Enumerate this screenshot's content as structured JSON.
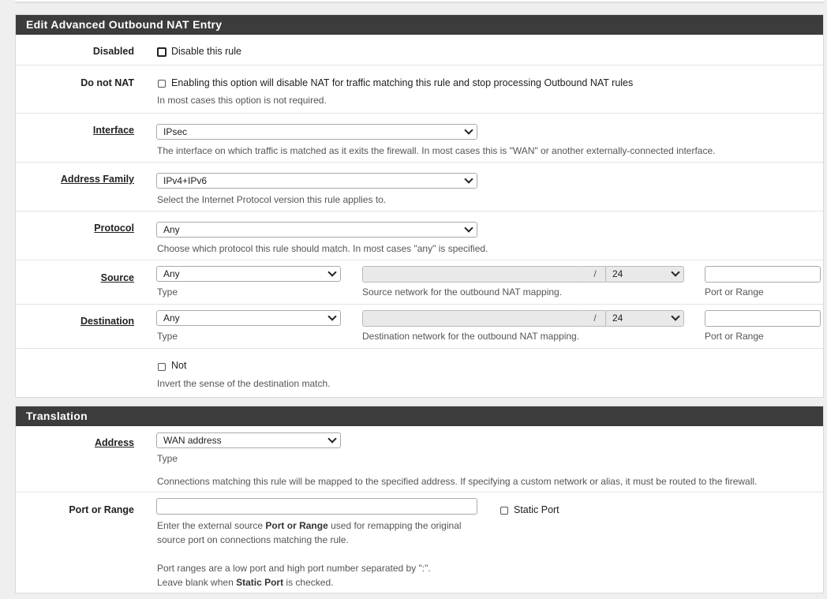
{
  "nat_panel": {
    "heading": "Edit Advanced Outbound NAT Entry",
    "disabled": {
      "label": "Disabled",
      "checkbox_text": "Disable this rule"
    },
    "do_not_nat": {
      "label": "Do not NAT",
      "checkbox_text": "Enabling this option will disable NAT for traffic matching this rule and stop processing Outbound NAT rules",
      "help": "In most cases this option is not required."
    },
    "interface": {
      "label": "Interface",
      "value": "IPsec",
      "help": "The interface on which traffic is matched as it exits the firewall. In most cases this is \"WAN\" or another externally-connected interface."
    },
    "address_family": {
      "label": "Address Family",
      "value": "IPv4+IPv6",
      "help": "Select the Internet Protocol version this rule applies to."
    },
    "protocol": {
      "label": "Protocol",
      "value": "Any",
      "help": "Choose which protocol this rule should match. In most cases \"any\" is specified."
    },
    "source": {
      "label": "Source",
      "type_value": "Any",
      "type_help": "Type",
      "network_value": "",
      "slash": "/",
      "mask_value": "24",
      "network_help": "Source network for the outbound NAT mapping.",
      "port_value": "",
      "port_help": "Port or Range"
    },
    "destination": {
      "label": "Destination",
      "type_value": "Any",
      "type_help": "Type",
      "network_value": "",
      "slash": "/",
      "mask_value": "24",
      "network_help": "Destination network for the outbound NAT mapping.",
      "port_value": "",
      "port_help": "Port or Range"
    },
    "not": {
      "checkbox_text": "Not",
      "help": "Invert the sense of the destination match."
    }
  },
  "translation_panel": {
    "heading": "Translation",
    "address": {
      "label": "Address",
      "value": "WAN address",
      "type_help": "Type",
      "help": "Connections matching this rule will be mapped to the specified address. If specifying a custom network or alias, it must be routed to the firewall."
    },
    "port_or_range": {
      "label": "Port or Range",
      "value": "",
      "static_port_text": "Static Port",
      "help_line1_a": "Enter the external source ",
      "help_line1_b": "Port or Range",
      "help_line1_c": " used for remapping the original",
      "help_line2": "source port on connections matching the rule.",
      "help_line3": "Port ranges are a low port and high port number separated by \":\".",
      "help_line4_a": "Leave blank when ",
      "help_line4_b": "Static Port",
      "help_line4_c": " is checked."
    }
  }
}
